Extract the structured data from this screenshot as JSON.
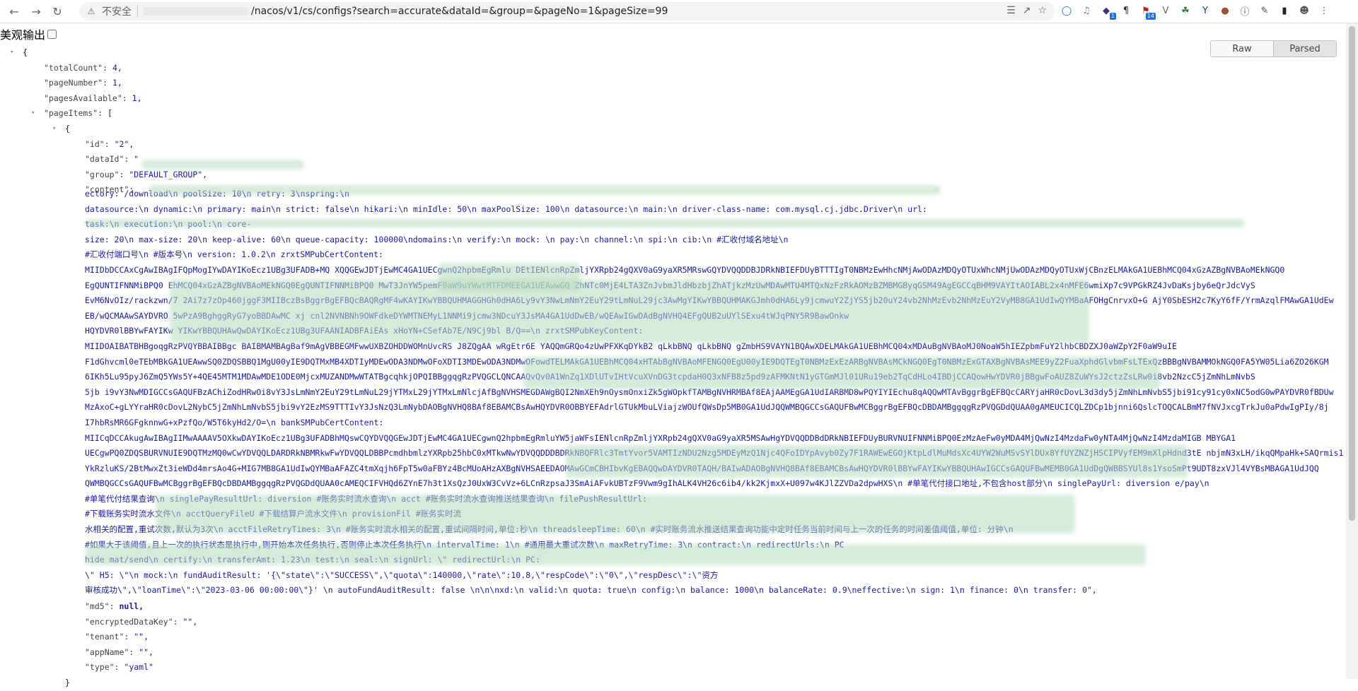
{
  "browser": {
    "insecure_label": "不安全",
    "url_path": "/nacos/v1/cs/configs?search=accurate&dataId=&group=&pageNo=1&pageSize=99"
  },
  "page": {
    "pretty_print_label": "美观输出",
    "raw_label": "Raw",
    "parsed_label": "Parsed"
  },
  "json": {
    "open_brace": "{",
    "totalCount_key": "\"totalCount\":",
    "totalCount_val": "4,",
    "pageNumber_key": "\"pageNumber\":",
    "pageNumber_val": "1,",
    "pagesAvailable_key": "\"pagesAvailable\":",
    "pagesAvailable_val": "1,",
    "pageItems_key": "\"pageItems\":",
    "pageItems_open": "[",
    "item_open": "{",
    "id_key": "\"id\":",
    "id_val": "\"2\",",
    "dataId_key": "\"dataId\":",
    "dataId_val": "\"",
    "group_key": "\"group\":",
    "group_val": "\"DEFAULT_GROUP\",",
    "content_key": "\"content\":",
    "md5_key": "\"md5\":",
    "md5_val": "null,",
    "encryptedDataKey_key": "\"encryptedDataKey\":",
    "encryptedDataKey_val": "\"\",",
    "tenant_key": "\"tenant\":",
    "tenant_val": "\"\",",
    "appName_key": "\"appName\":",
    "appName_val": "\"\",",
    "type_key": "\"type\":",
    "type_val": "\"yaml\"",
    "item_close": "}"
  },
  "content_lines": [
    "                                                                                                                                                        ectory: /download\\n    poolSize: 10\\n    retry: 3\\nspring:\\n",
    "datasource:\\n      dynamic:\\n         primary: main\\n        strict: false\\n        hikari:\\n              minIdle: 50\\n          maxPoolSize: 100\\n        datasource:\\n          main:\\n            driver-class-name: com.mysql.cj.jdbc.Driver\\n          url:",
    "                                                                                                                                         task:\\n        execution:\\n          pool:\\n          core-",
    "size: 20\\n          max-size: 20\\n          keep-alive: 60\\n          queue-capacity: 100000\\ndomains:\\n  verify:\\n          mock: \\n  pay:\\n    channel:\\n      spi:\\n      cib:\\n       #汇收付域名地址\\n",
    "#汇收付端口号\\n                    #版本号\\n          version: 1.0.2\\n                          zrxtSMPubCertContent:",
    "MIIDbDCCAxCgAwIBAgIFQpMogIYwDAYIKoEcz1UBg3UFADB+MQ             XQQGEwJDTjEwMC4GA1UECgwnQ2hpbmEgRmlu          DEtIENlcnRpZmljYXRpb24gQXV0aG9yaXR5MRswGQYDVQQDDBJDRkNBIEFDUyBTTTIgT0NBMzEwHhcNMjAwODAzMDQyOTUxWhcNMjUwODAzMDQyOTUxWjCBnzELMAkGA1UEBhMCQ04xGzAZBgNVBAoMEkNGQ0",
    "EgQUNTIFNNMiBPQ0                                 EhMCQ04xGzAZBgNVBAoMEkNGQ0EgQUNTIFNNMiBPQ0                   MwT3JnYW5pemF0aW9uYWwtMTFDMEEGA1UEAwwGQ        ZhNTc0MjE4LTA3ZnJvbmJldHbzbjZhATjkzMzUwMDAwMTU4MTQxNzFzRkAOMzBZMBMGByqGSM49AgEGCCqBHM9VAYItAOIABL2x4nMFE6wmiXp7c9VPGkRZ4JvDaKsjby6eQrJdcVyS",
    "EvM6NvOIz/rackzwn/7                          2Ai7z7zOp460jggF3MIIBczBsBggrBgEFBQcBAQRgMF4wKAYIKwYBBQUHMAGGHGh0dHA6Ly9vY3NwLmNmY2EuY29tLmNuL29jc3AwMgYIKwYBBQUHMAKGJmh0dHA6Ly9jcmwuY2ZjYS5jb20uY24vb2NhMzEvb2NhMzEuY2VyMB8GA1UdIwQYMBaAFOHgCnrvxO+G                AjY0SbESH2c7KyY6fF/YrmAzqlFMAwGA1UdEw",
    "EB/wQCMAAwSAYDVRO      5wPzA9BghggRyG7yoBBDAwMC                                                                                             xj            cnl2NVNBNh9OWFdkeDYWMTNEMyL1NNMi9jcmw3NDcuY3JsMA4GA1UdDwEB/wQEAwIGwDAdBgNVHQ4EFgQUB2uUYlSExu4tWJqPNY5R9BawOnkw",
    "HQYDVR0lBBYwFAYIKw             YIKwYBBQUHAwQwDAYIKoEcz1UBg3UFAANIADBFAiEAs            xHoYN+CSefAb7E/N9Cj9bl           B/Q==\\n                    zrxtSMPubKeyContent:",
    "MIIDOAIBATBHBgoqgRzPVQYBBAIBBgc                 BAIBMAMBAgBaf9mAgVBBEGMFwwUXBZOHDDWOMnUvcRS          J8ZQgAA     wRgEtr6E  YAQQmGRQo4zUwPFXKqDYkB2          qLkbBNQ            qLkbBNQ    gZmbHS9VAYN1BQAwXDELMAkGA1UEBhMCQ04xMDAuBgNVBAoMJ0NoaW5hIEZpbmFuY2lhbCBDZXJ0aWZpY2F0aW9uIE",
    "F1dGhvcml0eTEbMBkGA1UEAwwSQ0ZDQSBBQ1MgU00yIE9DQTMxMB4XDTIyMDEwODA3NDMwOFoXDTI3MDEwODA3NDMwOFowdTELMAkGA1UEBhMCQ04xHTAbBgNVBAoMFENGQ0EgU00yIE9DQTEgT0NBMzExEzARBgNVBAsMCkNGQ0EgT0NBMzExGTAXBgNVBAsMEE9yZ2FuaXphdGlvbmFsLTExQzBBBgNVBAMMOkNGQ0FA5YW05Lia6ZO26KGM",
    "6IKh5Lu95pyJ6ZmQ5YWs5Y+4QE45MTM1MDAwMDE1ODE0MjcxMUZANDMwWTATBgcqhkjOPQIBBggqgRzPVQGCLQNCAAQvQv0A1WnZq1XDlUTvIHtVcuXVnDG3tcpdaH0Q3xNFB8z5pd9zAFMKNtN1yGTGmMJl01URu19eb2TqCdHLo4IBDjCCAQowHwYDVR0jBBgwFoAUZ8ZuWYsJ2ctzZsLRw0i8vb2NzcC5jZmNhLmNvbS",
    "5jb i9vY3NwMDIGCCsGAQUFBzAChiZodHRwOi8vY3JsLmNmY2EuY29tLmNuL29jYTMxL29jYTMxLmNlcjAfBgNVHSMEGDAWgBQI2NmXEh9nOysmOnxiZk5gWOpkfTAMBgNVHRMBAf8EAjAAMEgGA1UdIARBMD8wPQYIYIEchu8qAQQwMTAvBggrBgEFBQcCARYjaHR0cDovL3d3dy5jZmNhLmNvbS5jbi91cy91cy0xNC5odG0wPAYDVR0fBDUw",
    "MzAxoC+gLYYraHR0cDovL2NybC5jZmNhLmNvbS5jbi9vY2EzMS9TTTIvY3JsNzQ3LmNybDAOBgNVHQ8BAf8EBAMCBsAwHQYDVR0OBBYEFAdrlGTUkMbuLViajzWOUfQWsDp5MB0GA1UdJQQWMBQGCCsGAQUFBwMCBggrBgEFBQcDBDAMBggqgRzPVQGDdQUAA0gAMEUCICQLZDCp1bjnni6QslcTOQCALBmM7fNVJxcgTrkJu0aPdwIgPIy/8j",
    "I7hbRsMR6GFgknnwG+xPzfQo/W5T6kyHd2/O=\\n                          bankSMPubCertContent:",
    "MIICqDCCAkugAwIBAgIIMwAAAAV5OXkwDAYIKoEcz1UBg3UFADBhMQswCQYDVQQGEwJDTjEwMC4GA1UECgwnQ2hpbmEgRmluYW5jaWFsIENlcnRpZmljYXRpb24gQXV0aG9yaXR5MSAwHgYDVQQDDBdDRkNBIEFDUyBURVNUIFNNMiBPQ0EzMzAeFw0yMDA4MjQwNzI4MzdaFw0yNTA4MjQwNzI4MzdaMIGB                               MBYGA1",
    "UECgwPQ0ZDQSBURVNUIE9DQTMzMQ0wCwYDVQQLDARDRkNBMRkwFwYDVQQLDBBPcmdhbmlzYXRpb25hbC0xMTkwNwYDVQQDDDBDRkNBQFRlc3TmtYvor5VAMTIzNDU2Nzg5MDEyMzQ1Njc4QFoIDYpAvyb0Zy7F1RAWEwEGOjKtpLdlMuMdsXc4UYW2WuMSvSYlDUx8YfUYZNZjHSCIPVyfEM9mXlpHdnd3tE          nbjmN3xLH/ikqQMpaHk+SAQrmis1UG",
    "YkRzluKS/2BtMwxZt3ieWDd4mrsAo4G+MIG7MB8GA1UdIwQYMBaAFAZC4tmXqjh6FpT5w0aFBYz4BcMUoAHzAXBgNVHSAEEDAOMAwGCmCBHIbvKgEBAQQwDAYDVR0TAQH/BAIwADAOBgNVHQ8BAf8EBAMCBsAwHQYDVR0lBBYwFAYIKwYBBQUHAwIGCCsGAQUFBwMEMB0GA1UdDgQWBBSYUl8s1YsoSmPt9UDT8zxVJl4VYBsMBAGA1UdJQQ",
    "QWMBQGCCsGAQUFBwMCBggrBgEFBQcDBDAMBggqgRzPVQGDdQUAA0cAMEQCIFVHQd6ZYnE7h3t1XsQzJ0UxW3CvVz+6LCnRzpsaJ3SmAiAFvkUBTzF9Vwm9gIhALK4VH26c6ib4/kk2KjmxX+U097w4KJlZZVDa2dpwHXS\\n           #单笔代付接口地址,不包含host部分\\n        singlePayUrl: diversion                 e/pay\\n",
    "#单笔代付结果查询\\n        singlePayResultUrl: diversion                                       #账务实时流水查询\\n        acct                                   #账务实时流水查询推送结果查询\\n        filePushResultUrl:",
    "                                       #下载账务实时流水文件\\n        acctQueryFileU                                  #下载结算户流水文件\\n        provisionFil                                     #账务实时流",
    "水相关的配置,重试次数,默认为3次\\n        acctFileRetryTimes: 3\\n          #账务实时流水相关的配置,重试间隔时间,单位:秒\\n        threadsleepTime: 60\\n        #实时账务流水推送结果查询功能中定时任务当前时间与上一次的任务的时间差值阈值,单位: 分钟\\n",
    "#如果大于该阈值,且上一次的执行状态是执行中,则开始本次任务执行,否则停止本次任务执行\\n        intervalTime: 1\\n        #通用最大重试次数\\n        maxRetryTime: 3\\n    contract:\\n    redirectUrls:\\n    PC",
    "hide                                                 mat/send\\n    certify:\\n    transferAmt: 1.23\\n    test:\\n    seal:\\n     signUrl: \\\"                                       redirectUrl:\\n           PC:",
    "\\\"                                                        H5:                                                     \\\"\\n  mock:\\n    fundAuditResult: '{\\\"state\\\":\\\"SUCCESS\\\",\\\"quota\\\":140000,\\\"rate\\\":10.8,\\\"respCode\\\":\\\"0\\\",\\\"respDesc\\\":\\\"资方",
    "审核成功\\\",\\\"loanTime\\\":\\\"2023-03-06 00:00:00\\\"}' \\n    autoFundAuditResult: false \\n\\n\\nxd:\\n  valid:\\n    quota: true\\n  config:\\n    balance: 1000\\n    balanceRate: 0.9\\neffective:\\n  sign: 1\\n  finance: 0\\n  transfer: 0\","
  ]
}
